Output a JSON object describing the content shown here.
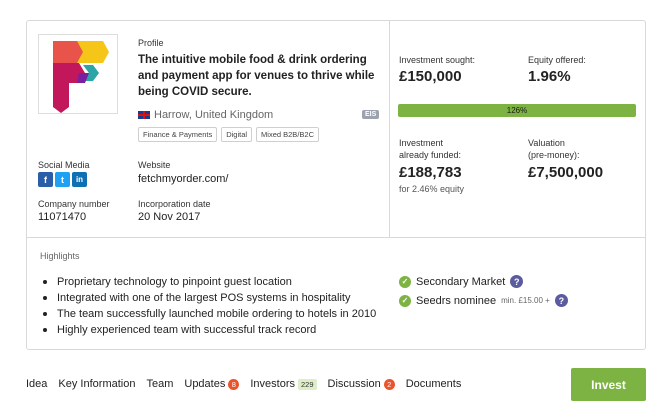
{
  "profile": {
    "label": "Profile",
    "description": "The intuitive mobile food & drink ordering and payment app for venues to thrive while being COVID secure.",
    "location": "Harrow, United Kingdom",
    "eis_badge": "EIS",
    "tags": [
      "Finance & Payments",
      "Digital",
      "Mixed B2B/B2C"
    ]
  },
  "social": {
    "label": "Social Media",
    "icons": [
      {
        "name": "facebook-icon",
        "glyph": "f"
      },
      {
        "name": "twitter-icon",
        "glyph": "t"
      },
      {
        "name": "linkedin-icon",
        "glyph": "in"
      }
    ]
  },
  "website": {
    "label": "Website",
    "value": "fetchmyorder.com/"
  },
  "company_number": {
    "label": "Company number",
    "value": "11071470"
  },
  "incorporation": {
    "label": "Incorporation date",
    "value": "20 Nov 2017"
  },
  "stats": {
    "investment_sought_label": "Investment sought:",
    "investment_sought": "£150,000",
    "equity_offered_label": "Equity offered:",
    "equity_offered": "1.96%",
    "progress_text": "126%",
    "progress_fraction": 1.0,
    "funded_label_1": "Investment",
    "funded_label_2": "already funded:",
    "funded": "£188,783",
    "funded_equity": "for 2.46% equity",
    "valuation_label_1": "Valuation",
    "valuation_label_2": "(pre-money):",
    "valuation": "£7,500,000"
  },
  "highlights": {
    "title": "Highlights",
    "items": [
      "Proprietary technology to pinpoint guest location",
      "Integrated with one of the largest POS systems in hospitality",
      "The team successfully launched mobile ordering to hotels in 2010",
      "Highly experienced team with successful track record"
    ],
    "badges": {
      "secondary_market": "Secondary Market",
      "seedrs_nominee": "Seedrs nominee",
      "min_note": "min. £15.00 +"
    }
  },
  "nav": {
    "idea": "Idea",
    "key_information": "Key Information",
    "team": "Team",
    "updates": "Updates",
    "updates_count": "8",
    "investors": "Investors",
    "investors_count": "229",
    "discussion": "Discussion",
    "discussion_count": "2",
    "documents": "Documents"
  },
  "invest_button": "Invest",
  "colors": {
    "accent_green": "#7cb342",
    "badge_red": "#e8542c",
    "logo_red": "#e8534a",
    "logo_yellow": "#f5c518",
    "logo_magenta": "#c2185b",
    "logo_teal": "#2ba5a5"
  }
}
